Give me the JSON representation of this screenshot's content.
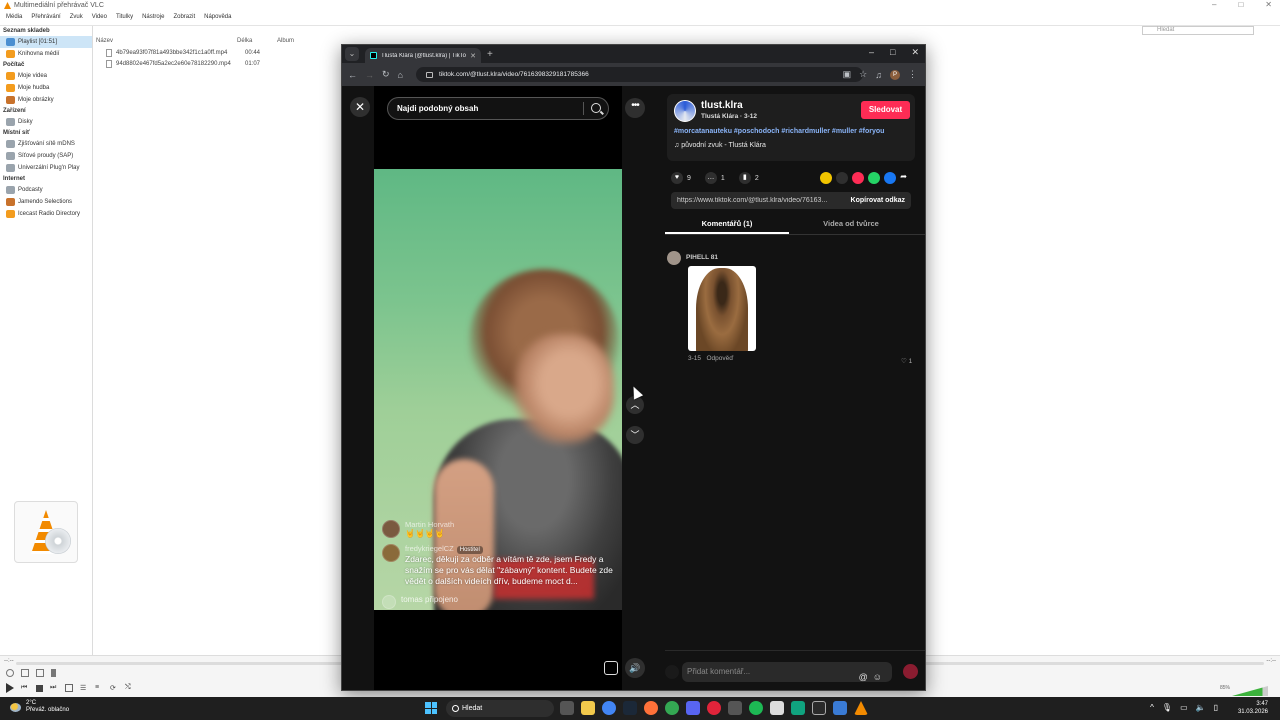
{
  "vlc": {
    "title": "Multimediální přehrávač VLC",
    "menu": [
      "Média",
      "Přehrávání",
      "Zvuk",
      "Video",
      "Titulky",
      "Nástroje",
      "Zobrazit",
      "Nápověda"
    ],
    "search_placeholder": "Hledat",
    "sidebar": {
      "sections": [
        {
          "heading": "Seznam skladeb",
          "items": [
            {
              "label": "Playlist [01:51]",
              "selected": true,
              "icon": "playlist-icon"
            },
            {
              "label": "Knihovna médií",
              "icon": "library-icon"
            }
          ]
        },
        {
          "heading": "Počítač",
          "items": [
            {
              "label": "Moje videa",
              "icon": "video-folder-icon"
            },
            {
              "label": "Moje hudba",
              "icon": "music-folder-icon"
            },
            {
              "label": "Moje obrázky",
              "icon": "pictures-folder-icon"
            }
          ]
        },
        {
          "heading": "Zařízení",
          "items": [
            {
              "label": "Disky",
              "icon": "disc-icon"
            }
          ]
        },
        {
          "heading": "Místní síť",
          "items": [
            {
              "label": "Zjišťování sítě mDNS",
              "icon": "network-icon"
            },
            {
              "label": "Síťové proudy (SAP)",
              "icon": "network-icon"
            },
            {
              "label": "Univerzální Plug'n Play",
              "icon": "network-icon"
            }
          ]
        },
        {
          "heading": "Internet",
          "items": [
            {
              "label": "Podcasty",
              "icon": "podcast-icon"
            },
            {
              "label": "Jamendo Selections",
              "icon": "jamendo-icon"
            },
            {
              "label": "Icecast Radio Directory",
              "icon": "radio-icon"
            }
          ]
        }
      ]
    },
    "columns": {
      "name": "Název",
      "duration": "Délka",
      "album": "Album"
    },
    "playlist": [
      {
        "name": "4b79ea93f07f81a493bbe342f1c1a0ff.mp4",
        "duration": "00:44"
      },
      {
        "name": "94d8802e467fd5a2ec2e60e78182290.mp4",
        "duration": "01:07"
      }
    ],
    "time_left": "--:--",
    "time_right": "--:--",
    "volume": "85%"
  },
  "chrome": {
    "tab_title": "Tlustá Klára (@tlust.klra) | TikTok",
    "url": "tiktok.com/@tlust.klra/video/7616398329181785366",
    "profile_letter": "P"
  },
  "tiktok": {
    "search_placeholder": "Najdi podobný obsah",
    "author": {
      "handle": "tlust.klra",
      "subtitle": "Tlustá Klára · 3-12",
      "follow_label": "Sledovat"
    },
    "hashtags": "#morcatanauteku #poschodoch #richardmuller #muller #foryou",
    "sound": "původní zvuk - Tlustá Klára",
    "stats": {
      "likes": "9",
      "comments": "1",
      "saves": "2"
    },
    "share_url": "https://www.tiktok.com/@tlust.klra/video/76163...",
    "copy_label": "Kopírovat odkaz",
    "tabs": {
      "comments": "Komentářů (1)",
      "creator_videos": "Videa od tvůrce"
    },
    "comment": {
      "author": "PIHELL 81",
      "date": "3-15",
      "reply_label": "Odpověď",
      "likes": "1"
    },
    "comment_placeholder": "Přidat komentář...",
    "video_chat": [
      {
        "name": "Martin Horvath",
        "message": "🤘🤘🤘🤘",
        "badge": ""
      },
      {
        "name": "fredykriegelCZ",
        "badge": "Hostitel",
        "message": "Zdarec, děkuji za odběr a vítám tě zde, jsem Fredy a snažím se pro vás dělat \"zábavný\" kontent. Budete zde vědět o dalších videích dřív, budeme moct d..."
      }
    ],
    "join_notice": "tomas připojeno"
  },
  "taskbar": {
    "weather_temp": "2°C",
    "weather_desc": "Převáž. oblačno",
    "search_label": "Hledat",
    "time": "3:47",
    "date": "31.03.2026"
  }
}
